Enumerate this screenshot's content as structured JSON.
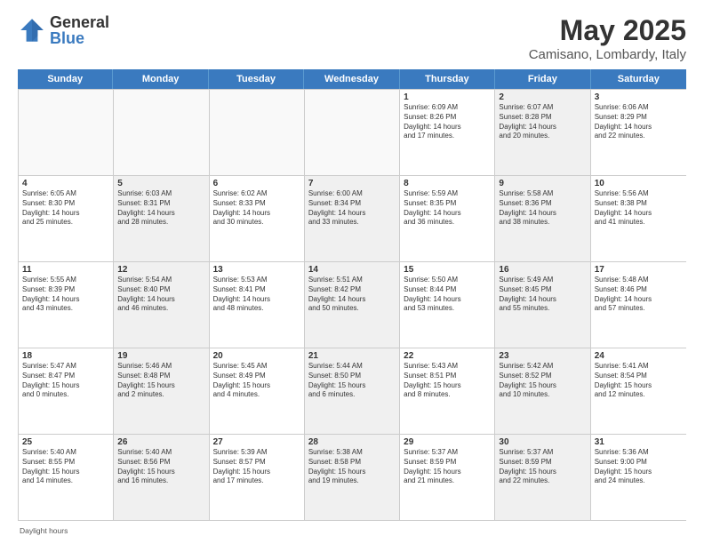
{
  "logo": {
    "general": "General",
    "blue": "Blue"
  },
  "title": {
    "month": "May 2025",
    "location": "Camisano, Lombardy, Italy"
  },
  "days_of_week": [
    "Sunday",
    "Monday",
    "Tuesday",
    "Wednesday",
    "Thursday",
    "Friday",
    "Saturday"
  ],
  "weeks": [
    [
      {
        "day": "",
        "text": "",
        "empty": true
      },
      {
        "day": "",
        "text": "",
        "empty": true
      },
      {
        "day": "",
        "text": "",
        "empty": true
      },
      {
        "day": "",
        "text": "",
        "empty": true
      },
      {
        "day": "1",
        "text": "Sunrise: 6:09 AM\nSunset: 8:26 PM\nDaylight: 14 hours\nand 17 minutes.",
        "empty": false,
        "shaded": false
      },
      {
        "day": "2",
        "text": "Sunrise: 6:07 AM\nSunset: 8:28 PM\nDaylight: 14 hours\nand 20 minutes.",
        "empty": false,
        "shaded": true
      },
      {
        "day": "3",
        "text": "Sunrise: 6:06 AM\nSunset: 8:29 PM\nDaylight: 14 hours\nand 22 minutes.",
        "empty": false,
        "shaded": false
      }
    ],
    [
      {
        "day": "4",
        "text": "Sunrise: 6:05 AM\nSunset: 8:30 PM\nDaylight: 14 hours\nand 25 minutes.",
        "empty": false,
        "shaded": false
      },
      {
        "day": "5",
        "text": "Sunrise: 6:03 AM\nSunset: 8:31 PM\nDaylight: 14 hours\nand 28 minutes.",
        "empty": false,
        "shaded": true
      },
      {
        "day": "6",
        "text": "Sunrise: 6:02 AM\nSunset: 8:33 PM\nDaylight: 14 hours\nand 30 minutes.",
        "empty": false,
        "shaded": false
      },
      {
        "day": "7",
        "text": "Sunrise: 6:00 AM\nSunset: 8:34 PM\nDaylight: 14 hours\nand 33 minutes.",
        "empty": false,
        "shaded": true
      },
      {
        "day": "8",
        "text": "Sunrise: 5:59 AM\nSunset: 8:35 PM\nDaylight: 14 hours\nand 36 minutes.",
        "empty": false,
        "shaded": false
      },
      {
        "day": "9",
        "text": "Sunrise: 5:58 AM\nSunset: 8:36 PM\nDaylight: 14 hours\nand 38 minutes.",
        "empty": false,
        "shaded": true
      },
      {
        "day": "10",
        "text": "Sunrise: 5:56 AM\nSunset: 8:38 PM\nDaylight: 14 hours\nand 41 minutes.",
        "empty": false,
        "shaded": false
      }
    ],
    [
      {
        "day": "11",
        "text": "Sunrise: 5:55 AM\nSunset: 8:39 PM\nDaylight: 14 hours\nand 43 minutes.",
        "empty": false,
        "shaded": false
      },
      {
        "day": "12",
        "text": "Sunrise: 5:54 AM\nSunset: 8:40 PM\nDaylight: 14 hours\nand 46 minutes.",
        "empty": false,
        "shaded": true
      },
      {
        "day": "13",
        "text": "Sunrise: 5:53 AM\nSunset: 8:41 PM\nDaylight: 14 hours\nand 48 minutes.",
        "empty": false,
        "shaded": false
      },
      {
        "day": "14",
        "text": "Sunrise: 5:51 AM\nSunset: 8:42 PM\nDaylight: 14 hours\nand 50 minutes.",
        "empty": false,
        "shaded": true
      },
      {
        "day": "15",
        "text": "Sunrise: 5:50 AM\nSunset: 8:44 PM\nDaylight: 14 hours\nand 53 minutes.",
        "empty": false,
        "shaded": false
      },
      {
        "day": "16",
        "text": "Sunrise: 5:49 AM\nSunset: 8:45 PM\nDaylight: 14 hours\nand 55 minutes.",
        "empty": false,
        "shaded": true
      },
      {
        "day": "17",
        "text": "Sunrise: 5:48 AM\nSunset: 8:46 PM\nDaylight: 14 hours\nand 57 minutes.",
        "empty": false,
        "shaded": false
      }
    ],
    [
      {
        "day": "18",
        "text": "Sunrise: 5:47 AM\nSunset: 8:47 PM\nDaylight: 15 hours\nand 0 minutes.",
        "empty": false,
        "shaded": false
      },
      {
        "day": "19",
        "text": "Sunrise: 5:46 AM\nSunset: 8:48 PM\nDaylight: 15 hours\nand 2 minutes.",
        "empty": false,
        "shaded": true
      },
      {
        "day": "20",
        "text": "Sunrise: 5:45 AM\nSunset: 8:49 PM\nDaylight: 15 hours\nand 4 minutes.",
        "empty": false,
        "shaded": false
      },
      {
        "day": "21",
        "text": "Sunrise: 5:44 AM\nSunset: 8:50 PM\nDaylight: 15 hours\nand 6 minutes.",
        "empty": false,
        "shaded": true
      },
      {
        "day": "22",
        "text": "Sunrise: 5:43 AM\nSunset: 8:51 PM\nDaylight: 15 hours\nand 8 minutes.",
        "empty": false,
        "shaded": false
      },
      {
        "day": "23",
        "text": "Sunrise: 5:42 AM\nSunset: 8:52 PM\nDaylight: 15 hours\nand 10 minutes.",
        "empty": false,
        "shaded": true
      },
      {
        "day": "24",
        "text": "Sunrise: 5:41 AM\nSunset: 8:54 PM\nDaylight: 15 hours\nand 12 minutes.",
        "empty": false,
        "shaded": false
      }
    ],
    [
      {
        "day": "25",
        "text": "Sunrise: 5:40 AM\nSunset: 8:55 PM\nDaylight: 15 hours\nand 14 minutes.",
        "empty": false,
        "shaded": false
      },
      {
        "day": "26",
        "text": "Sunrise: 5:40 AM\nSunset: 8:56 PM\nDaylight: 15 hours\nand 16 minutes.",
        "empty": false,
        "shaded": true
      },
      {
        "day": "27",
        "text": "Sunrise: 5:39 AM\nSunset: 8:57 PM\nDaylight: 15 hours\nand 17 minutes.",
        "empty": false,
        "shaded": false
      },
      {
        "day": "28",
        "text": "Sunrise: 5:38 AM\nSunset: 8:58 PM\nDaylight: 15 hours\nand 19 minutes.",
        "empty": false,
        "shaded": true
      },
      {
        "day": "29",
        "text": "Sunrise: 5:37 AM\nSunset: 8:59 PM\nDaylight: 15 hours\nand 21 minutes.",
        "empty": false,
        "shaded": false
      },
      {
        "day": "30",
        "text": "Sunrise: 5:37 AM\nSunset: 8:59 PM\nDaylight: 15 hours\nand 22 minutes.",
        "empty": false,
        "shaded": true
      },
      {
        "day": "31",
        "text": "Sunrise: 5:36 AM\nSunset: 9:00 PM\nDaylight: 15 hours\nand 24 minutes.",
        "empty": false,
        "shaded": false
      }
    ]
  ],
  "footer": {
    "daylight_note": "Daylight hours"
  }
}
